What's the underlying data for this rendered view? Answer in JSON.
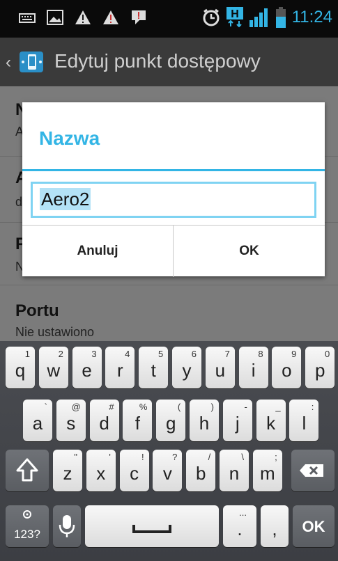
{
  "status_bar": {
    "left_icons": [
      "keyboard-icon",
      "image-icon",
      "warning-icon",
      "warning-icon",
      "notification-icon"
    ],
    "right_icons": [
      "alarm-icon",
      "hplus-icon",
      "signal-icon",
      "battery-icon"
    ],
    "time": "11:24",
    "network_type": "H"
  },
  "action_bar": {
    "title": "Edytuj punkt dostępowy"
  },
  "background_list": [
    {
      "title": "N",
      "subtitle": "A"
    },
    {
      "title": "A",
      "subtitle": "d"
    },
    {
      "title": "P",
      "subtitle": "N"
    },
    {
      "title": "Portu",
      "subtitle": "Nie ustawiono"
    }
  ],
  "dialog": {
    "title": "Nazwa",
    "input_value": "Aero2",
    "cancel_label": "Anuluj",
    "ok_label": "OK"
  },
  "keyboard": {
    "row1": [
      {
        "main": "q",
        "sup": "1"
      },
      {
        "main": "w",
        "sup": "2"
      },
      {
        "main": "e",
        "sup": "3"
      },
      {
        "main": "r",
        "sup": "4"
      },
      {
        "main": "t",
        "sup": "5"
      },
      {
        "main": "y",
        "sup": "6"
      },
      {
        "main": "u",
        "sup": "7"
      },
      {
        "main": "i",
        "sup": "8"
      },
      {
        "main": "o",
        "sup": "9"
      },
      {
        "main": "p",
        "sup": "0"
      }
    ],
    "row2": [
      {
        "main": "a",
        "sup": "`"
      },
      {
        "main": "s",
        "sup": "@"
      },
      {
        "main": "d",
        "sup": "#"
      },
      {
        "main": "f",
        "sup": "%"
      },
      {
        "main": "g",
        "sup": "("
      },
      {
        "main": "h",
        "sup": ")"
      },
      {
        "main": "j",
        "sup": "-"
      },
      {
        "main": "k",
        "sup": "_"
      },
      {
        "main": "l",
        "sup": ":"
      }
    ],
    "row3": [
      {
        "main": "z",
        "sup": "\""
      },
      {
        "main": "x",
        "sup": "'"
      },
      {
        "main": "c",
        "sup": "!"
      },
      {
        "main": "v",
        "sup": "?"
      },
      {
        "main": "b",
        "sup": "/"
      },
      {
        "main": "n",
        "sup": "\\"
      },
      {
        "main": "m",
        "sup": ";"
      }
    ],
    "symbols_label": "123?",
    "period_label": ".",
    "period_sup": "...",
    "comma_label": ",",
    "ok_label": "OK"
  },
  "colors": {
    "accent": "#33b5e5",
    "action_bar": "#3a3a3a",
    "dim_background": "#7b7b7b",
    "keyboard_bg": "#45474c"
  }
}
